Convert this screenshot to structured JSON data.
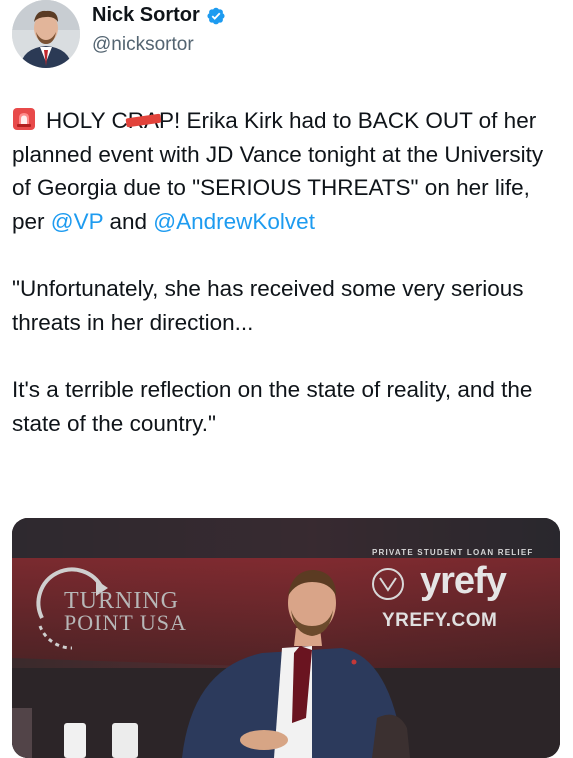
{
  "author": {
    "name": "Nick Sortor",
    "handle": "@nicksortor"
  },
  "tweet": {
    "siren_icon": "police-siren-emoji",
    "line1_before": "HOLY C",
    "line1_redacted": "RA",
    "line1_after": "P! Erika Kirk had to BACK OUT of her planned event with JD Vance tonight at the University of Georgia due to \"SERIOUS THREATS\" on her life, per ",
    "mention_vp": "@VP",
    "and_text": " and ",
    "mention_kolvet": "@AndrewKolvet",
    "quote1": "\"Unfortunately, she has received some very serious threats in her direction...",
    "quote2": "It's a terrible reflection on the state of reality, and the state of the country.\""
  },
  "media": {
    "turning_point_line1": "TURNING",
    "turning_point_line2": "POINT USA",
    "sponsor_tagline": "PRIVATE STUDENT LOAN RELIEF",
    "sponsor_name": "yrefy",
    "sponsor_url": "YREFY.COM"
  },
  "colors": {
    "link": "#1d9bf0",
    "verified": "#1d9bf0",
    "text": "#0f1419",
    "secondary": "#536471"
  }
}
